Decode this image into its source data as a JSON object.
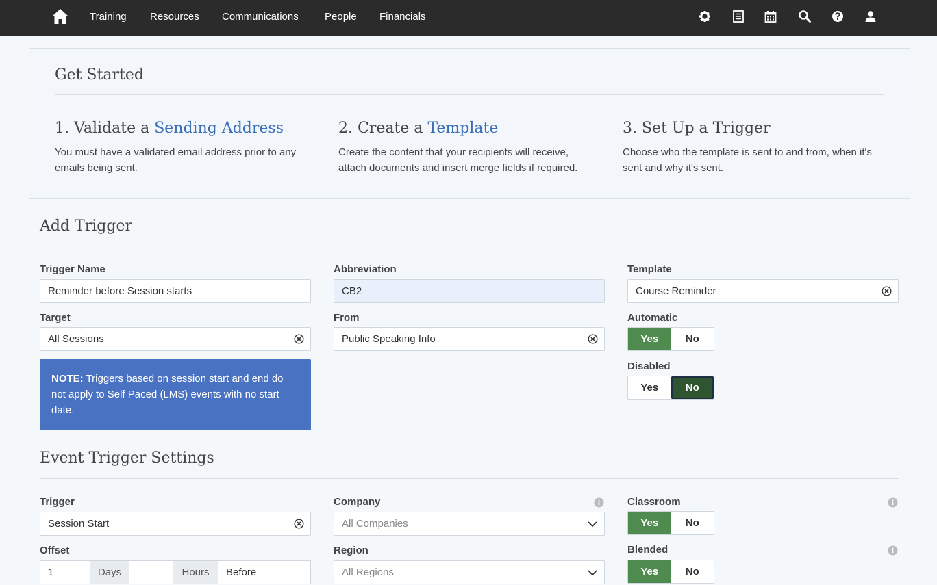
{
  "nav": {
    "home_icon": "home-icon",
    "links": [
      "Training",
      "Resources",
      "Communications",
      "People",
      "Financials"
    ],
    "icons": [
      "gear-icon",
      "list-icon",
      "calendar-icon",
      "search-icon",
      "help-icon",
      "user-icon"
    ]
  },
  "get_started": {
    "title": "Get Started",
    "steps": [
      {
        "prefix": "1. Validate a ",
        "link": "Sending Address",
        "desc": "You must have a validated email address prior to any emails being sent."
      },
      {
        "prefix": "2. Create a ",
        "link": "Template",
        "desc": "Create the content that your recipients will receive, attach documents and insert merge fields if required."
      },
      {
        "prefix": "3. Set Up a Trigger",
        "link": "",
        "desc": "Choose who the template is sent to and from, when it's sent and why it's sent."
      }
    ]
  },
  "add_trigger": {
    "title": "Add Trigger",
    "trigger_name_label": "Trigger Name",
    "trigger_name_value": "Reminder before Session starts",
    "abbreviation_label": "Abbreviation",
    "abbreviation_value": "CB2",
    "template_label": "Template",
    "template_value": "Course Reminder",
    "target_label": "Target",
    "target_value": "All Sessions",
    "from_label": "From",
    "from_value": "Public Speaking Info",
    "automatic_label": "Automatic",
    "automatic_selected": "Yes",
    "disabled_label": "Disabled",
    "disabled_selected": "No",
    "yes": "Yes",
    "no": "No",
    "note_bold": "NOTE:",
    "note_text": " Triggers based on session start and end do not apply to Self Paced (LMS) events with no start date."
  },
  "event_settings": {
    "title": "Event Trigger Settings",
    "trigger_label": "Trigger",
    "trigger_value": "Session Start",
    "company_label": "Company",
    "company_value": "All Companies",
    "classroom_label": "Classroom",
    "classroom_selected": "Yes",
    "offset_label": "Offset",
    "offset_days_value": "1",
    "offset_days_unit": "Days",
    "offset_hours_value": "",
    "offset_hours_unit": "Hours",
    "offset_when": "Before",
    "region_label": "Region",
    "region_value": "All Regions",
    "blended_label": "Blended",
    "blended_selected": "Yes"
  },
  "colors": {
    "nav_bg": "#2b2b2b",
    "link": "#3b6fb6",
    "toggle_on": "#4f8a4f",
    "note_bg": "#4a72c2"
  }
}
